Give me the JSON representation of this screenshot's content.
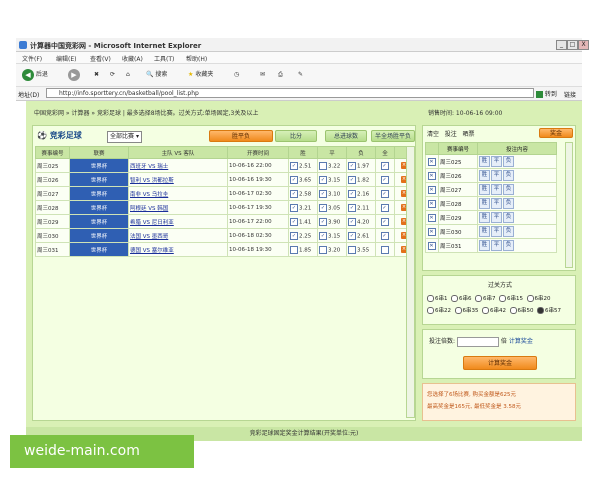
{
  "window": {
    "title": "计算器中国竞彩网 - Microsoft Internet Explorer",
    "controls": [
      "_",
      "□",
      "X"
    ]
  },
  "menu": [
    "文件(F)",
    "编辑(E)",
    "查看(V)",
    "收藏(A)",
    "工具(T)",
    "帮助(H)"
  ],
  "toolbar": {
    "back": "后退",
    "search": "搜索",
    "favorites": "收藏夹"
  },
  "address": {
    "label": "地址(D)",
    "url": "http://info.sporttery.cn/basketball/pool_list.php",
    "go": "转到",
    "links": "链接"
  },
  "page": {
    "info_line": "中国竞彩网 » 计算器 » 竞彩足球 | 最多选择8场比赛。过关方式:单场固定,3关及以上",
    "time_line": "销售时间: 10-06-16 09:00",
    "logo": "竞彩足球",
    "select_value": "全部比赛",
    "buttons": [
      "胜平负",
      "比分",
      "总进球数",
      "半全场胜平负"
    ],
    "columns": [
      "赛事编号",
      "联赛",
      "主队 VS 客队",
      "开赛时间",
      "胜",
      "平",
      "负",
      "全",
      ""
    ],
    "rows": [
      {
        "id": "周三025",
        "league": "世界杯",
        "match": "西班牙 VS 瑞士",
        "time": "10-06-16 22:00",
        "w": "2.51",
        "d": "3.22",
        "l": "1.97"
      },
      {
        "id": "周三026",
        "league": "世界杯",
        "match": "智利 VS 洪都拉斯",
        "time": "10-06-16 19:30",
        "w": "3.65",
        "d": "3.15",
        "l": "1.82"
      },
      {
        "id": "周三027",
        "league": "世界杯",
        "match": "南非 VS 乌拉圭",
        "time": "10-06-17 02:30",
        "w": "2.58",
        "d": "3.10",
        "l": "2.16"
      },
      {
        "id": "周三028",
        "league": "世界杯",
        "match": "阿根廷 VS 韩国",
        "time": "10-06-17 19:30",
        "w": "3.21",
        "d": "3.05",
        "l": "2.11"
      },
      {
        "id": "周三029",
        "league": "世界杯",
        "match": "希腊 VS 尼日利亚",
        "time": "10-06-17 22:00",
        "w": "1.41",
        "d": "3.90",
        "l": "4.20"
      },
      {
        "id": "周三030",
        "league": "世界杯",
        "match": "法国 VS 墨西哥",
        "time": "10-06-18 02:30",
        "w": "2.25",
        "d": "3.15",
        "l": "2.61"
      },
      {
        "id": "周三031",
        "league": "世界杯",
        "match": "德国 VS 塞尔维亚",
        "time": "10-06-18 19:30",
        "w": "1.85",
        "d": "3.20",
        "l": "3.55"
      }
    ],
    "footer": "竞彩足球固定奖金计算结果(开奖单位:元)"
  },
  "right_panel": {
    "tabs": [
      "清空",
      "投注",
      "晒票",
      "奖金"
    ],
    "active_tab": "奖金",
    "columns": [
      "",
      "赛事编号",
      "投注内容"
    ],
    "rows": [
      {
        "id": "周三025",
        "picks": [
          "胜",
          "平",
          "负"
        ]
      },
      {
        "id": "周三026",
        "picks": [
          "胜",
          "平",
          "负"
        ]
      },
      {
        "id": "周三027",
        "picks": [
          "胜",
          "平",
          "负"
        ]
      },
      {
        "id": "周三028",
        "picks": [
          "胜",
          "平",
          "负"
        ]
      },
      {
        "id": "周三029",
        "picks": [
          "胜",
          "平",
          "负"
        ]
      },
      {
        "id": "周三030",
        "picks": [
          "胜",
          "平",
          "负"
        ]
      },
      {
        "id": "周三031",
        "picks": [
          "胜",
          "平",
          "负"
        ]
      }
    ],
    "pass_title": "过关方式",
    "pass_options_row1": [
      "6串1",
      "6串6",
      "6串7",
      "6串15",
      "6串20"
    ],
    "pass_options_row2": [
      "6串22",
      "6串35",
      "6串42",
      "6串50",
      "6串57"
    ],
    "multiple_label": "投注倍数:",
    "multiple_unit": "倍",
    "multiple_link": "计算奖金",
    "calc_button": "计算奖金",
    "result_line1": "您选择了6场比赛, 购买金额是625元",
    "result_line2": "最高奖金是165元, 最低奖金是 3.58元"
  },
  "watermark": "weide-main.com",
  "colors": {
    "page_bg": "#d9f0b5",
    "league_bg": "#2f5fb3",
    "accent_orange": "#f08a1c"
  }
}
